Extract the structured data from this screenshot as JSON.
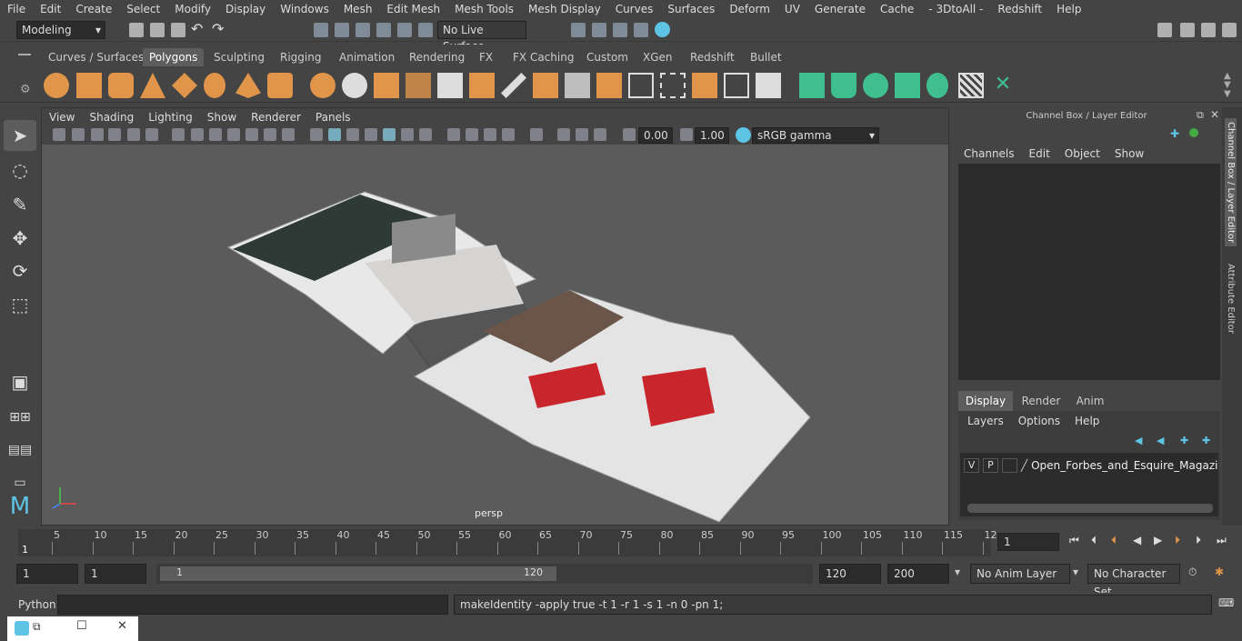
{
  "menubar": {
    "items": [
      "File",
      "Edit",
      "Create",
      "Select",
      "Modify",
      "Display",
      "Windows",
      "Mesh",
      "Edit Mesh",
      "Mesh Tools",
      "Mesh Display",
      "Curves",
      "Surfaces",
      "Deform",
      "UV",
      "Generate",
      "Cache",
      "- 3DtoAll -",
      "Redshift",
      "Help"
    ]
  },
  "status": {
    "mode": "Modeling",
    "live_surface": "No Live Surface"
  },
  "shelf": {
    "tabs": [
      "Curves / Surfaces",
      "Polygons",
      "Sculpting",
      "Rigging",
      "Animation",
      "Rendering",
      "FX",
      "FX Caching",
      "Custom",
      "XGen",
      "Redshift",
      "Bullet"
    ],
    "active_tab": "Polygons"
  },
  "viewport": {
    "menus": [
      "View",
      "Shading",
      "Lighting",
      "Show",
      "Renderer",
      "Panels"
    ],
    "exposure": "0.00",
    "gamma": "1.00",
    "color_space": "sRGB gamma",
    "camera_label": "persp"
  },
  "channel_box": {
    "title": "Channel Box / Layer Editor",
    "menus": [
      "Channels",
      "Edit",
      "Object",
      "Show"
    ],
    "layer_tabs": [
      "Display",
      "Render",
      "Anim"
    ],
    "active_layer_tab": "Display",
    "layer_menus": [
      "Layers",
      "Options",
      "Help"
    ],
    "layer": {
      "v": "V",
      "p": "P",
      "name": "Open_Forbes_and_Esquire_Magazine"
    },
    "side_tabs": [
      "Channel Box / Layer Editor",
      "Attribute Editor"
    ]
  },
  "timeline": {
    "ticks": [
      "5",
      "10",
      "15",
      "20",
      "25",
      "30",
      "35",
      "40",
      "45",
      "50",
      "55",
      "60",
      "65",
      "70",
      "75",
      "80",
      "85",
      "90",
      "95",
      "100",
      "105",
      "110",
      "115",
      "12"
    ],
    "current_frame_marker": "1",
    "current_frame": "1"
  },
  "range": {
    "start": "1",
    "start2": "1",
    "slider_start": "1",
    "slider_end": "120",
    "end": "120",
    "end2": "200",
    "anim_layer": "No Anim Layer",
    "character_set": "No Character Set"
  },
  "command": {
    "language": "Python",
    "result": "makeIdentity -apply true -t 1 -r 1 -s 1 -n 0 -pn 1;"
  },
  "colors": {
    "bg": "#444444",
    "viewport": "#5b5b5b",
    "accent": "#5ec4e6",
    "shelf_icon": "#e0954a",
    "shelf_icon_green": "#3fbf8f"
  }
}
